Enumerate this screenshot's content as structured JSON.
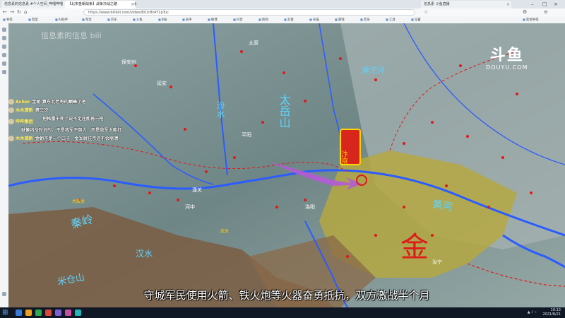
{
  "browser": {
    "tabs": [
      {
        "title": "信息素的信息素 #个人空间_哔哩哔哩"
      },
      {
        "title": "【北宋金朝战争】战争决战之路"
      },
      {
        "title": "信息素 斗鱼直播"
      }
    ],
    "new_tab_symbol": "+",
    "url": "https://www.bilibili.com/video/BV1r8z4Y1pTuc",
    "bookmarks": [
      "书签",
      "百度",
      "Ai助手",
      "淘宝",
      "京东",
      "斗鱼",
      "B站",
      "知乎",
      "微博",
      "抖音",
      "新闻",
      "云盘",
      "天猫",
      "游戏",
      "音乐",
      "工具",
      "设置",
      "其他书签"
    ]
  },
  "danmaku": [
    {
      "user": "Achor",
      "text": "金朝 算东北老哥的巅峰了吧"
    },
    {
      "user": "木木清新",
      "text": "第三次"
    },
    {
      "user": "",
      "text": "把格雷干死了说不定还能再一把"
    },
    {
      "user": "哔哔集团",
      "text": "你说的过 就很好"
    },
    {
      "user": "",
      "text": "就像内战时说的，不是我军不努力，而是敌军太能打"
    },
    {
      "user": "木木清新",
      "text": "金朝不是一个口子，金军就往京还不会崩溃"
    }
  ],
  "video": {
    "watermark": "信息素的信息 bili",
    "platform_logo_main": "斗鱼",
    "platform_logo_sub": "DOUYU.COM",
    "subtitle": "守城军民使用火箭、铁火炮等火器奋勇抵抗，双方激战半个月",
    "map_labels": [
      {
        "text": "金",
        "color": "#e01919"
      },
      {
        "text": "太岳山",
        "color": "#5fd5ff"
      },
      {
        "text": "秦岭",
        "color": "#5fd5ff"
      },
      {
        "text": "黄河",
        "color": "#5fd5ff"
      },
      {
        "text": "汴京",
        "color": "#ffd400"
      },
      {
        "text": "汝宁",
        "color": "#ffffff"
      },
      {
        "text": "太原",
        "color": "#ffffff"
      },
      {
        "text": "洛阳",
        "color": "#ffffff"
      },
      {
        "text": "河中",
        "color": "#ffffff"
      },
      {
        "text": "平阳",
        "color": "#ffffff"
      },
      {
        "text": "汾水",
        "color": "#5fd5ff"
      },
      {
        "text": "滹沱河",
        "color": "#5fd5ff"
      },
      {
        "text": "汉水",
        "color": "#5fd5ff"
      },
      {
        "text": "米仓山",
        "color": "#5fd5ff"
      },
      {
        "text": "大散关",
        "color": "#ffd400"
      },
      {
        "text": "武关",
        "color": "#ffd400"
      },
      {
        "text": "保安州",
        "color": "#ffffff"
      },
      {
        "text": "延安",
        "color": "#ffffff"
      },
      {
        "text": "潼关",
        "color": "#ffffff"
      }
    ]
  },
  "taskbar": {
    "time": "19:13",
    "date": "2021/8/21"
  },
  "colors": {
    "river": "#2b5cff",
    "jin_territory": "#b5a842",
    "song_territory": "#7c5a3f",
    "mountain": "#7c8f8e",
    "arrow": "#b45bd6",
    "border": "#e01919"
  }
}
